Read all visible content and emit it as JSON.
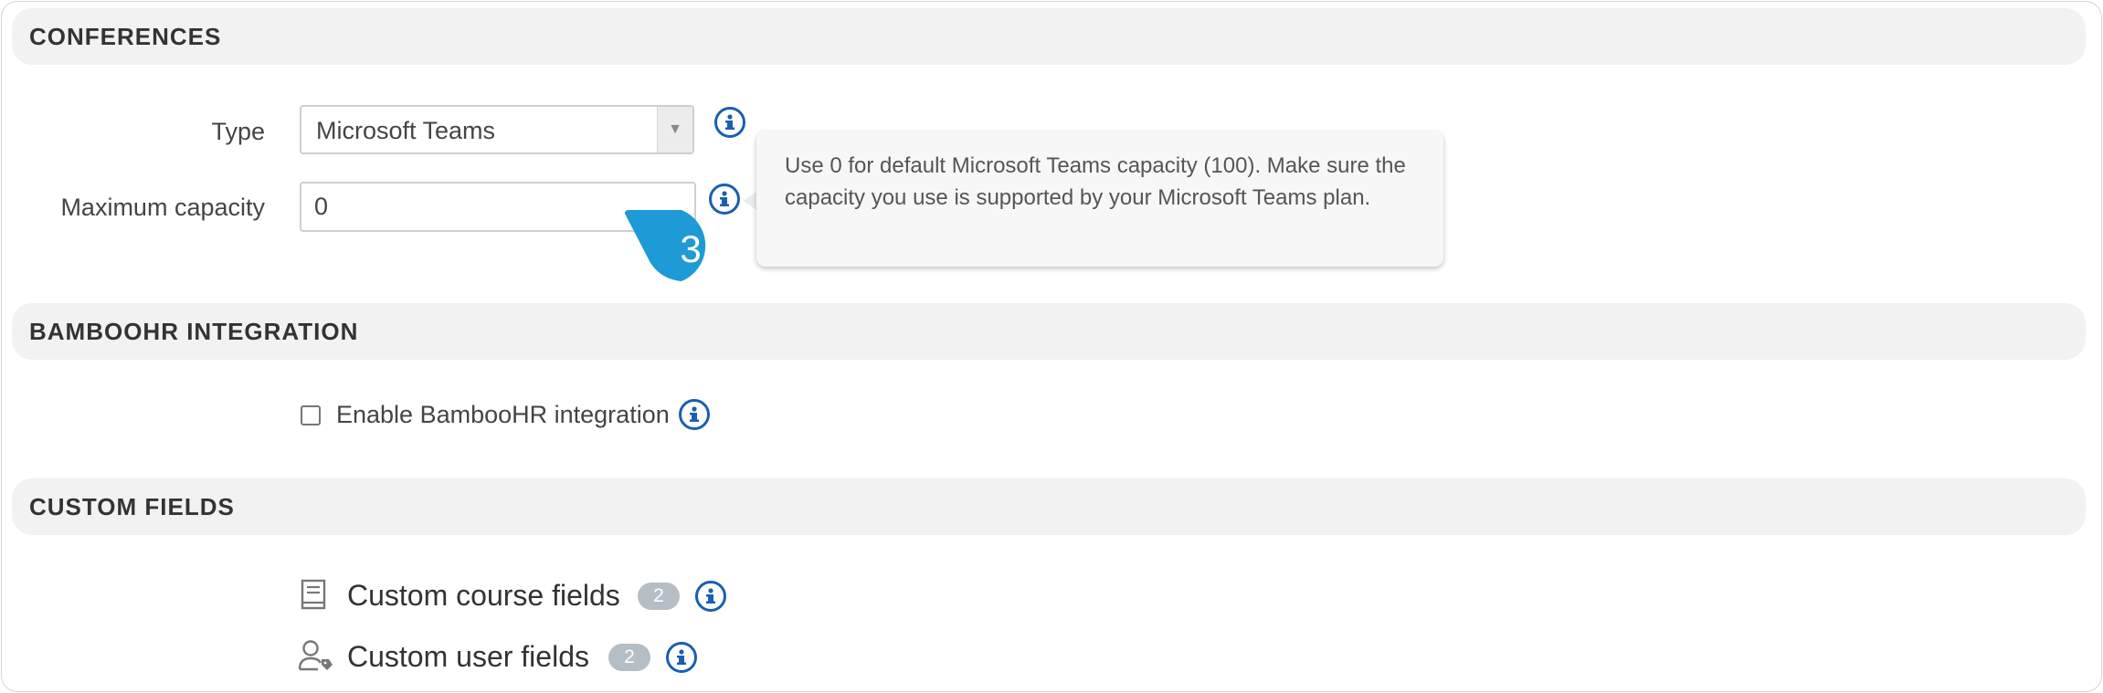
{
  "sections": {
    "conferences": "CONFERENCES",
    "bamboohr": "BAMBOOHR INTEGRATION",
    "custom_fields": "CUSTOM FIELDS"
  },
  "conferences": {
    "type_label": "Type",
    "type_value": "Microsoft Teams",
    "capacity_label": "Maximum capacity",
    "capacity_value": "0",
    "tooltip": "Use 0 for default Microsoft Teams capacity (100). Make sure the capacity you use is supported by your Microsoft Teams plan.",
    "callout_number": "3"
  },
  "bamboohr": {
    "checkbox_label": "Enable BambooHR integration",
    "checked": false
  },
  "custom_fields": {
    "items": [
      {
        "label": "Custom course fields",
        "count": "2",
        "icon": "book-icon"
      },
      {
        "label": "Custom user fields",
        "count": "2",
        "icon": "user-tag-icon"
      }
    ]
  },
  "colors": {
    "info_icon": "#1a5fb0",
    "callout": "#1e9ad6",
    "badge": "#b5bec4",
    "header_bg": "#f2f2f2"
  }
}
